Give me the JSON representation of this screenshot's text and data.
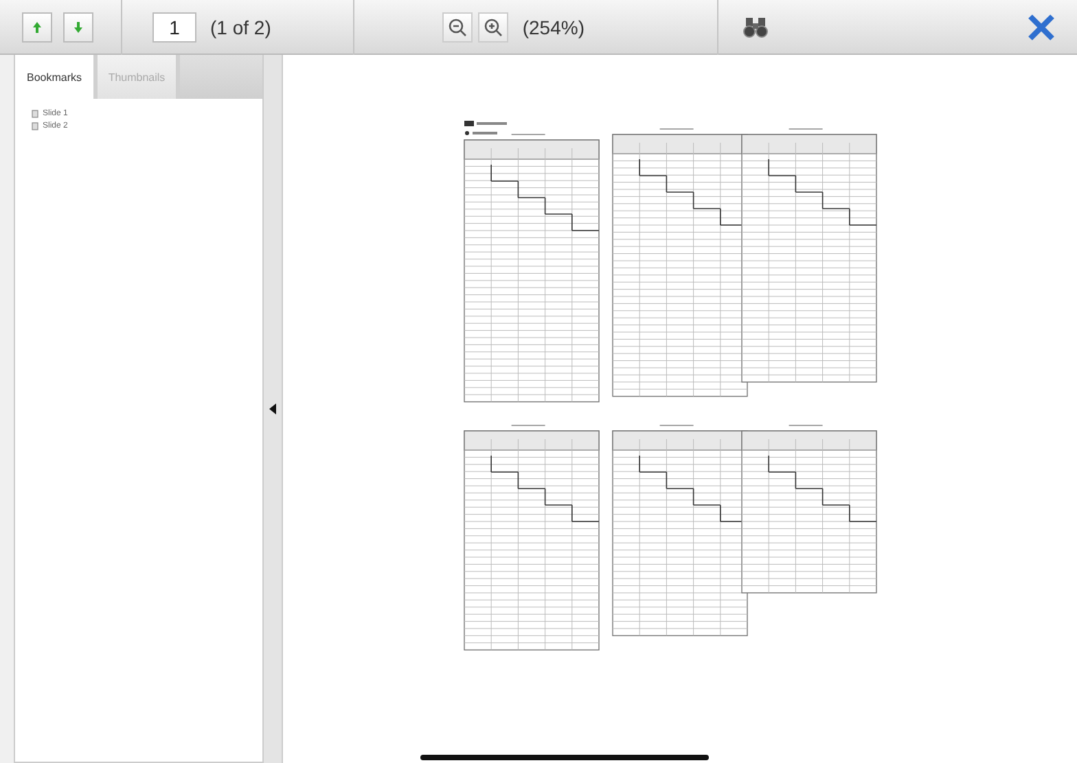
{
  "toolbar": {
    "page_input": "1",
    "page_count": "(1 of 2)",
    "zoom": "(254%)"
  },
  "sidebar": {
    "tabs": [
      {
        "label": "Bookmarks",
        "selected": true
      },
      {
        "label": "Thumbnails",
        "selected": false
      }
    ],
    "bookmarks": [
      {
        "label": "Slide 1"
      },
      {
        "label": "Slide 2"
      }
    ]
  }
}
